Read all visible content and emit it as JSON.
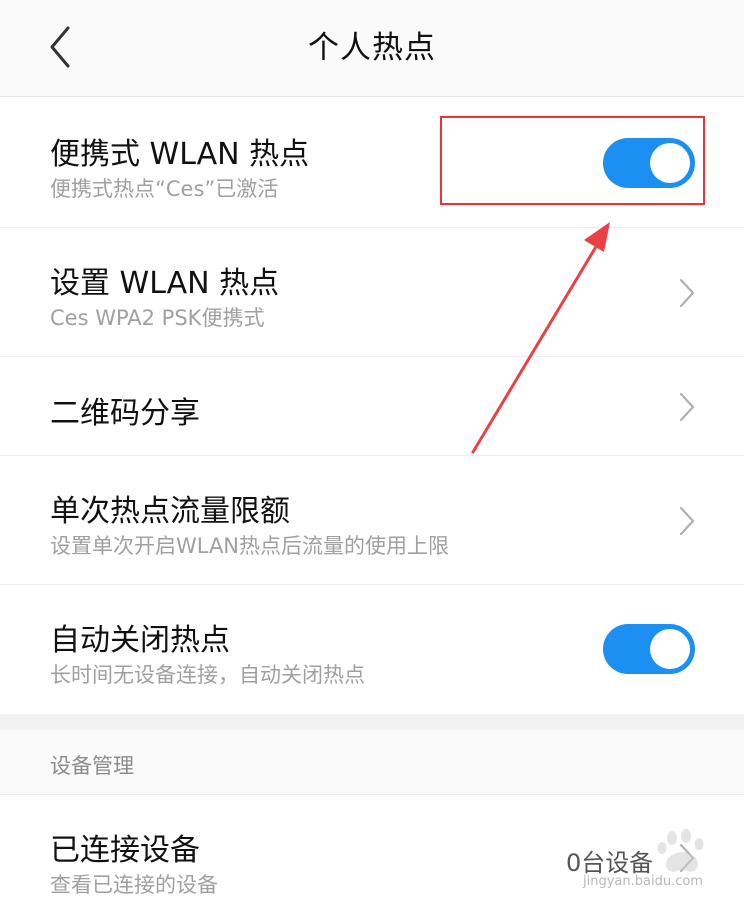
{
  "header": {
    "title": "个人热点"
  },
  "rows": {
    "portable": {
      "title": "便携式 WLAN 热点",
      "subtitle": "便携式热点“Ces”已激活",
      "enabled": true
    },
    "setup": {
      "title": "设置 WLAN 热点",
      "subtitle": "Ces WPA2 PSK便携式"
    },
    "qr": {
      "title": "二维码分享"
    },
    "limit": {
      "title": "单次热点流量限额",
      "subtitle": "设置单次开启WLAN热点后流量的使用上限"
    },
    "autoclose": {
      "title": "自动关闭热点",
      "subtitle": "长时间无设备连接，自动关闭热点",
      "enabled": true
    },
    "connected": {
      "title": "已连接设备",
      "subtitle": "查看已连接的设备",
      "value": "0台设备"
    }
  },
  "section": {
    "device_management": "设备管理"
  },
  "watermark": {
    "url": "jingyan.baidu.com"
  },
  "colors": {
    "toggle_on": "#1c8ff2",
    "annotation": "#e8323c"
  }
}
